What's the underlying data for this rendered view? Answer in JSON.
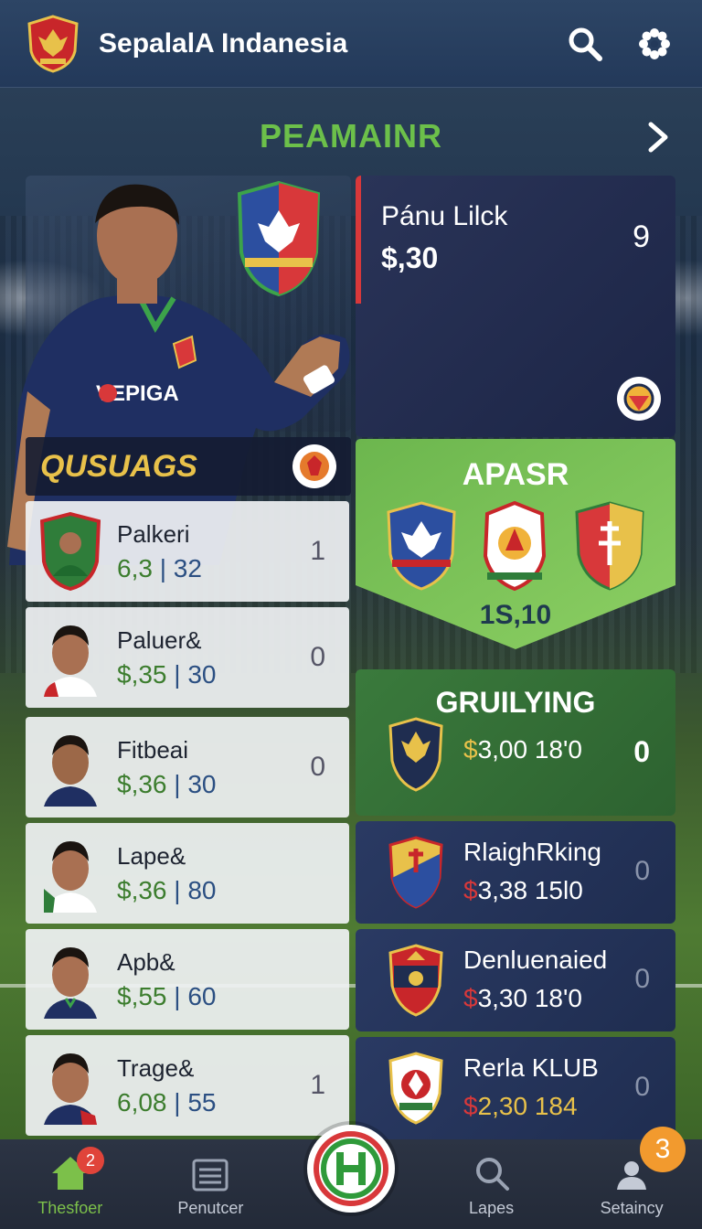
{
  "header": {
    "title": "SepalalA Indanesia"
  },
  "section": {
    "title": "PEAMAINR"
  },
  "featured": {
    "name": "Pánu Lilck",
    "price": "$,30",
    "number": "9"
  },
  "list": {
    "title": "QUSUAGS",
    "rows": [
      {
        "name": "Palkeri",
        "value1": "6,3",
        "value2": "32",
        "rank": "1"
      },
      {
        "name": "Paluer&",
        "value1": "$,35",
        "value2": "30",
        "rank": "0"
      },
      {
        "name": "Fitbeai",
        "value1": "$,36",
        "value2": "30",
        "rank": "0"
      },
      {
        "name": "Lape&",
        "value1": "$,36",
        "value2": "80",
        "rank": ""
      },
      {
        "name": "Apb&",
        "value1": "$,55",
        "value2": "60",
        "rank": ""
      },
      {
        "name": "Trage&",
        "value1": "6,08",
        "value2": "55",
        "rank": "1"
      }
    ]
  },
  "card_apasr": {
    "title": "APASR",
    "value": "1S,10"
  },
  "card_gruilying": {
    "title": "GRUILYING",
    "price": "3,00 18'0",
    "currency": "$",
    "number": "0"
  },
  "clubs": [
    {
      "name": "RlaighRking",
      "currency": "$",
      "price": "3,38 15l0",
      "number": "0"
    },
    {
      "name": "Denluenaied",
      "currency": "$",
      "price": "3,30 18'0",
      "number": "0"
    },
    {
      "name": "Rerla KLUB",
      "currency": "$",
      "price": "2,30 184",
      "number": "0"
    }
  ],
  "nav": {
    "home": "Thesfoer",
    "penutcer": "Penutcer",
    "lapes": "Lapes",
    "setaincy": "Setaincy",
    "home_badge": "2",
    "setaincy_badge": "3"
  },
  "colors": {
    "accent_green": "#6cc04a",
    "header": "#23395a",
    "gold": "#e8c14a",
    "red": "#d8383a",
    "orange": "#f29a2e"
  }
}
